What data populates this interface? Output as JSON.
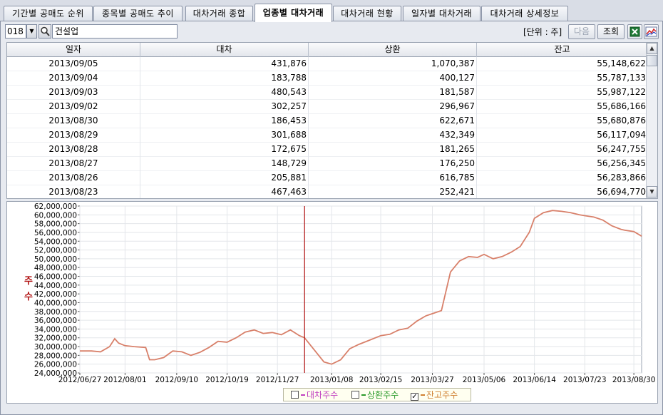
{
  "tabs": [
    {
      "label": "기간별 공매도 순위",
      "active": false
    },
    {
      "label": "종목별 공매도 추이",
      "active": false
    },
    {
      "label": "대차거래 종합",
      "active": false
    },
    {
      "label": "업종별 대차거래",
      "active": true
    },
    {
      "label": "대차거래 현황",
      "active": false
    },
    {
      "label": "일자별 대차거래",
      "active": false
    },
    {
      "label": "대차거래 상세정보",
      "active": false
    }
  ],
  "toolbar": {
    "code": "018",
    "dropdown_glyph": "▼",
    "name": "건설업",
    "unit_label": "[단위 : 주]",
    "next_label": "다음",
    "query_label": "조회"
  },
  "colors": {
    "accent_red": "#b01010",
    "balance_line": "#d8806a",
    "loan_legend": "#c040c0",
    "repay_legend": "#2a9a2a",
    "balance_legend": "#d08030"
  },
  "icons": [
    "dropdown-arrow-icon",
    "magnifier-icon",
    "excel-icon",
    "chart-icon",
    "scroll-up-icon",
    "scroll-down-icon"
  ],
  "table": {
    "columns": [
      "일자",
      "대차",
      "상환",
      "잔고"
    ],
    "rows": [
      [
        "2013/09/05",
        "431,876",
        "1,070,387",
        "55,148,622"
      ],
      [
        "2013/09/04",
        "183,788",
        "400,127",
        "55,787,133"
      ],
      [
        "2013/09/03",
        "480,543",
        "181,587",
        "55,987,122"
      ],
      [
        "2013/09/02",
        "302,257",
        "296,967",
        "55,686,166"
      ],
      [
        "2013/08/30",
        "186,453",
        "622,671",
        "55,680,876"
      ],
      [
        "2013/08/29",
        "301,688",
        "432,349",
        "56,117,094"
      ],
      [
        "2013/08/28",
        "172,675",
        "181,265",
        "56,247,755"
      ],
      [
        "2013/08/27",
        "148,729",
        "176,250",
        "56,256,345"
      ],
      [
        "2013/08/26",
        "205,881",
        "616,785",
        "56,283,866"
      ],
      [
        "2013/08/23",
        "467,463",
        "252,421",
        "56,694,770"
      ]
    ]
  },
  "chart_data": {
    "type": "line",
    "ylabel": "주\n수",
    "ylim": [
      24000000,
      62000000
    ],
    "ytick_step": 2000000,
    "y_ticks": [
      "62,000,000",
      "60,000,000",
      "58,000,000",
      "56,000,000",
      "54,000,000",
      "52,000,000",
      "50,000,000",
      "48,000,000",
      "46,000,000",
      "44,000,000",
      "42,000,000",
      "40,000,000",
      "38,000,000",
      "36,000,000",
      "34,000,000",
      "32,000,000",
      "30,000,000",
      "28,000,000",
      "26,000,000",
      "24,000,000"
    ],
    "x_ticks": [
      "2012/06/27",
      "2012/08/01",
      "2012/09/10",
      "2012/10/19",
      "2012/11/27",
      "2013/01/08",
      "2013/02/15",
      "2013/03/27",
      "2013/05/06",
      "2013/06/14",
      "2013/07/23",
      "2013/08/30"
    ],
    "xlim": [
      "2012/06/27",
      "2013/09/05"
    ],
    "grid": true,
    "cursor_date": "2012/12/18",
    "legend_placement": "bottom-center",
    "legend": [
      {
        "label": "대차주수",
        "checked": false
      },
      {
        "label": "상환주수",
        "checked": false
      },
      {
        "label": "잔고주수",
        "checked": true
      }
    ],
    "series": [
      {
        "name": "잔고주수",
        "x": [
          "2012/06/27",
          "2012/07/06",
          "2012/07/13",
          "2012/07/20",
          "2012/07/24",
          "2012/07/27",
          "2012/08/01",
          "2012/08/08",
          "2012/08/17",
          "2012/08/20",
          "2012/08/24",
          "2012/08/31",
          "2012/09/07",
          "2012/09/14",
          "2012/09/21",
          "2012/09/28",
          "2012/10/05",
          "2012/10/12",
          "2012/10/19",
          "2012/10/26",
          "2012/11/02",
          "2012/11/09",
          "2012/11/16",
          "2012/11/23",
          "2012/11/30",
          "2012/12/07",
          "2012/12/14",
          "2012/12/18",
          "2012/12/24",
          "2013/01/02",
          "2013/01/08",
          "2013/01/15",
          "2013/01/22",
          "2013/01/29",
          "2013/02/05",
          "2013/02/15",
          "2013/02/22",
          "2013/03/01",
          "2013/03/08",
          "2013/03/15",
          "2013/03/22",
          "2013/03/27",
          "2013/04/03",
          "2013/04/10",
          "2013/04/17",
          "2013/04/24",
          "2013/05/01",
          "2013/05/06",
          "2013/05/13",
          "2013/05/20",
          "2013/05/27",
          "2013/06/03",
          "2013/06/10",
          "2013/06/14",
          "2013/06/21",
          "2013/06/28",
          "2013/07/05",
          "2013/07/12",
          "2013/07/19",
          "2013/07/23",
          "2013/07/30",
          "2013/08/06",
          "2013/08/13",
          "2013/08/20",
          "2013/08/23",
          "2013/08/30",
          "2013/09/05"
        ],
        "y": [
          29000000,
          29000000,
          28800000,
          30000000,
          31800000,
          30800000,
          30200000,
          30000000,
          29800000,
          27000000,
          27000000,
          27500000,
          29000000,
          28800000,
          28000000,
          28700000,
          29800000,
          31200000,
          31000000,
          32000000,
          33300000,
          33800000,
          33000000,
          33200000,
          32700000,
          33800000,
          32500000,
          32000000,
          29800000,
          26500000,
          26000000,
          27000000,
          29500000,
          30500000,
          31300000,
          32500000,
          32800000,
          33800000,
          34200000,
          35800000,
          37000000,
          37500000,
          38200000,
          47000000,
          49500000,
          50500000,
          50300000,
          51000000,
          50000000,
          50500000,
          51500000,
          52800000,
          56000000,
          59200000,
          60500000,
          61000000,
          60800000,
          60500000,
          60000000,
          59800000,
          59500000,
          58800000,
          57500000,
          56700000,
          56500000,
          56200000,
          55148622
        ]
      }
    ]
  }
}
